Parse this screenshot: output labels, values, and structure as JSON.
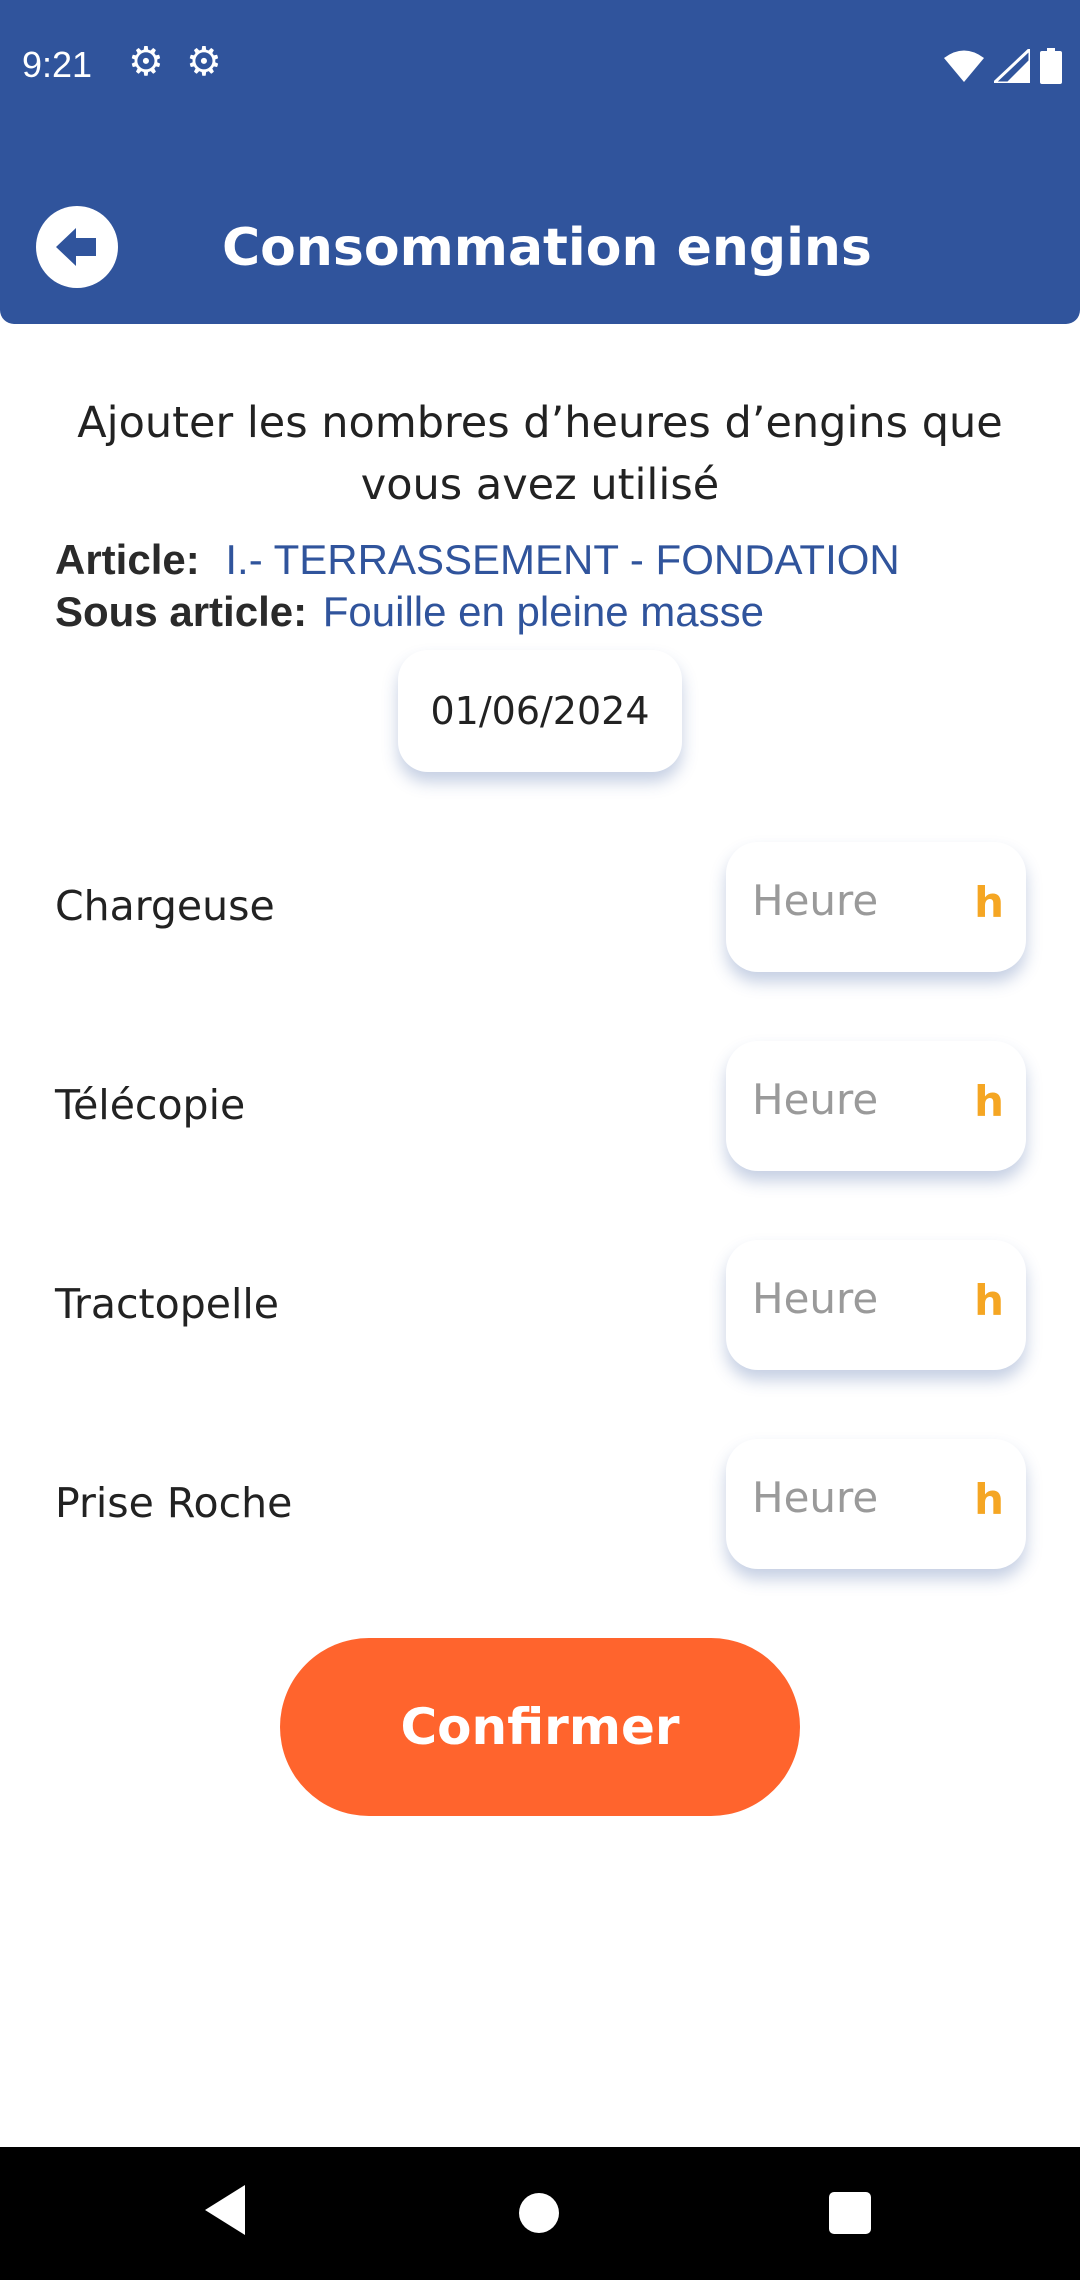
{
  "status_bar": {
    "time": "9:21",
    "icons": [
      "gear-icon",
      "gear-outline-icon",
      "wifi-icon",
      "signal-icon",
      "battery-icon"
    ]
  },
  "app_bar": {
    "title": "Consommation engins",
    "back_icon": "arrow-left-circle-icon"
  },
  "content": {
    "intro": "Ajouter les nombres d’heures d’engins que vous avez utilisé",
    "article_label": "Article:",
    "article_value": "I.- TERRASSEMENT - FONDATION",
    "sub_article_label": "Sous article:",
    "sub_article_value": "Fouille en pleine masse",
    "date": "01/06/2024"
  },
  "engines": [
    {
      "label": "Chargeuse",
      "placeholder": "Heure",
      "unit": "h"
    },
    {
      "label": "Télécopie",
      "placeholder": "Heure",
      "unit": "h"
    },
    {
      "label": "Tractopelle",
      "placeholder": "Heure",
      "unit": "h"
    },
    {
      "label": "Prise Roche",
      "placeholder": "Heure",
      "unit": "h"
    }
  ],
  "confirm_label": "Confirmer",
  "colors": {
    "primary": "#30549c",
    "accent": "#ff642d",
    "unit": "#f5a623"
  }
}
